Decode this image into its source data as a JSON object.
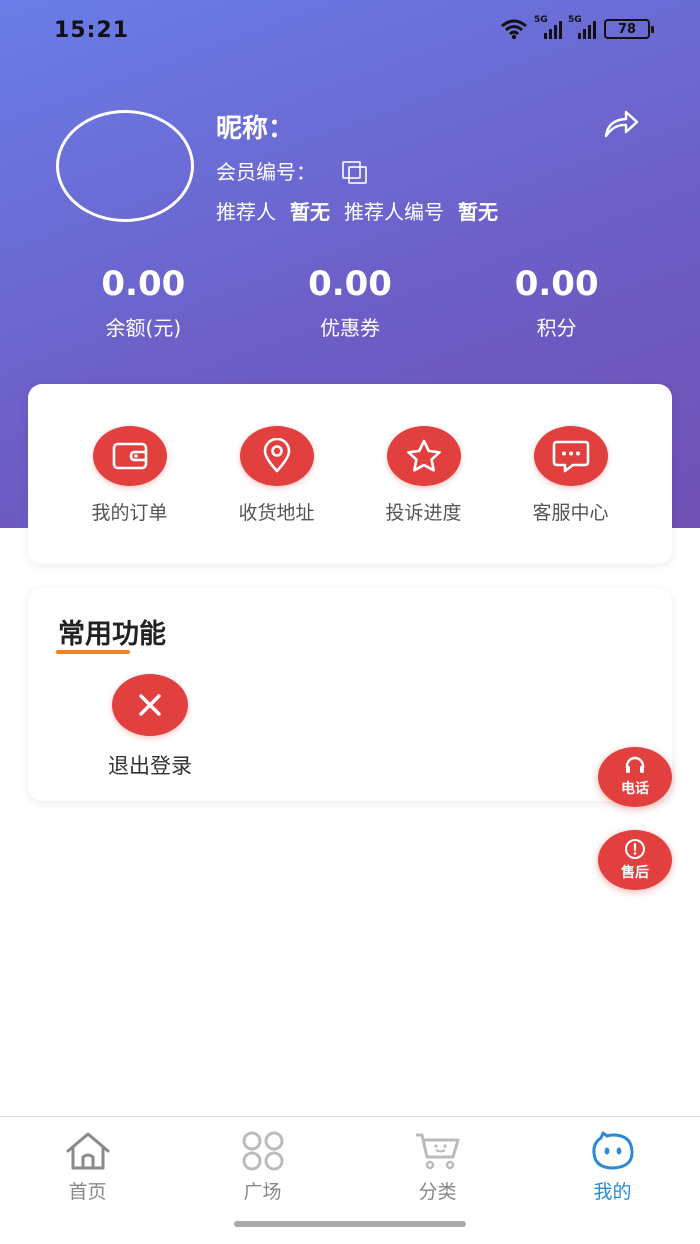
{
  "status": {
    "time": "15:21",
    "net1": "5G",
    "net2": "5G",
    "battery": "78"
  },
  "profile": {
    "nickname_label": "昵称：",
    "member_no_label": "会员编号：",
    "referrer_label": "推荐人",
    "referrer_value": "暂无",
    "referrer_no_label": "推荐人编号",
    "referrer_no_value": "暂无"
  },
  "stats": [
    {
      "value": "0.00",
      "label": "余额(元)"
    },
    {
      "value": "0.00",
      "label": "优惠券"
    },
    {
      "value": "0.00",
      "label": "积分"
    }
  ],
  "quick_actions": [
    {
      "label": "我的订单",
      "icon": "wallet-icon"
    },
    {
      "label": "收货地址",
      "icon": "location-pin-icon"
    },
    {
      "label": "投诉进度",
      "icon": "star-icon"
    },
    {
      "label": "客服中心",
      "icon": "chat-bubble-icon"
    }
  ],
  "common": {
    "title": "常用功能",
    "logout_label": "退出登录"
  },
  "floating": {
    "phone_label": "电话",
    "aftersale_label": "售后"
  },
  "tabs": [
    {
      "label": "首页",
      "icon": "home-icon"
    },
    {
      "label": "广场",
      "icon": "grid-icon"
    },
    {
      "label": "分类",
      "icon": "cart-icon"
    },
    {
      "label": "我的",
      "icon": "smiley-icon",
      "active": true
    }
  ],
  "colors": {
    "accent_red": "#e2403f",
    "active_tab": "#2a8ad8",
    "underline": "#f0821f",
    "hero_start": "#6a7de8",
    "hero_end": "#7050b5"
  }
}
